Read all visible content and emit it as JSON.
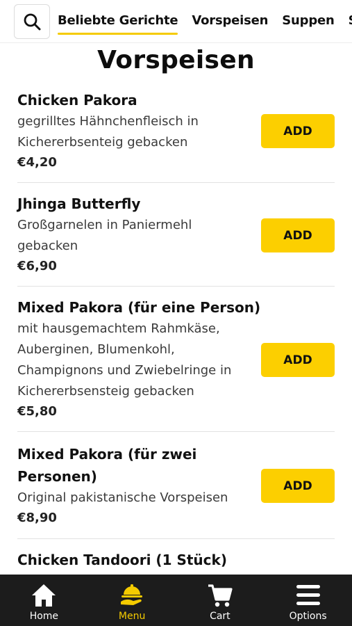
{
  "header": {
    "tabs": [
      {
        "label": "Beliebte Gerichte",
        "active": true
      },
      {
        "label": "Vorspeisen",
        "active": false
      },
      {
        "label": "Suppen",
        "active": false
      },
      {
        "label": "S",
        "active": false
      }
    ]
  },
  "section": {
    "title": "Vorspeisen"
  },
  "items": [
    {
      "name": "Chicken Pakora",
      "description": "gegrilltes Hähnchenfleisch in Kichererbsenteig gebacken",
      "price": "€4,20",
      "add_label": "ADD"
    },
    {
      "name": "Jhinga Butterfly",
      "description": "Großgarnelen in Paniermehl gebacken",
      "price": "€6,90",
      "add_label": "ADD"
    },
    {
      "name": "Mixed Pakora (für eine Person)",
      "description": "mit hausgemachtem Rahmkäse, Auberginen, Blumenkohl, Champignons und Zwiebelringe in Kichererbsensteig gebacken",
      "price": "€5,80",
      "add_label": "ADD"
    },
    {
      "name": "Mixed Pakora (für zwei Personen)",
      "description": "Original pakistanische Vorspeisen",
      "price": "€8,90",
      "add_label": "ADD"
    },
    {
      "name": "Chicken Tandoori (1 Stück)",
      "description": "",
      "price": "",
      "add_label": ""
    }
  ],
  "bottom_nav": [
    {
      "label": "Home",
      "icon": "home-icon",
      "active": false
    },
    {
      "label": "Menu",
      "icon": "menu-icon",
      "active": true
    },
    {
      "label": "Cart",
      "icon": "cart-icon",
      "active": false
    },
    {
      "label": "Options",
      "icon": "options-icon",
      "active": false
    }
  ],
  "colors": {
    "accent": "#fccf00",
    "nav_background": "#1c1c1c"
  }
}
